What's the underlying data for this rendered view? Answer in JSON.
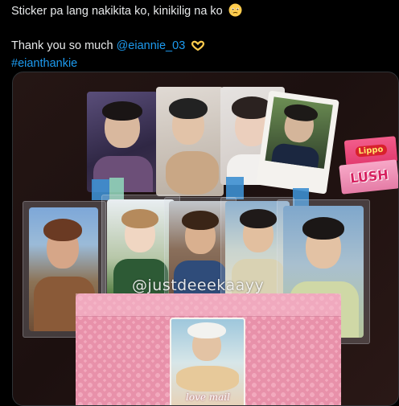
{
  "tweet": {
    "line1": "Sticker pa lang nakikita ko, kinikilig na ko",
    "line1_emoji": "face-holding-back-tears-icon",
    "line2_prefix": "Thank you so much ",
    "mention": "@eiannie_03",
    "line2_emoji": "heart-hands-icon",
    "hashtag": "#eianthankie"
  },
  "photo": {
    "watermark": "@justdeeekaayy",
    "candy1_label": "Lippo",
    "candy2_label": "LUSH",
    "envelope_label": "love mail",
    "colors": {
      "background": "#000000",
      "link": "#1d9bf0",
      "mailer_pink": "#f2a9bd",
      "tape_blue": "#3d8fd0"
    }
  }
}
